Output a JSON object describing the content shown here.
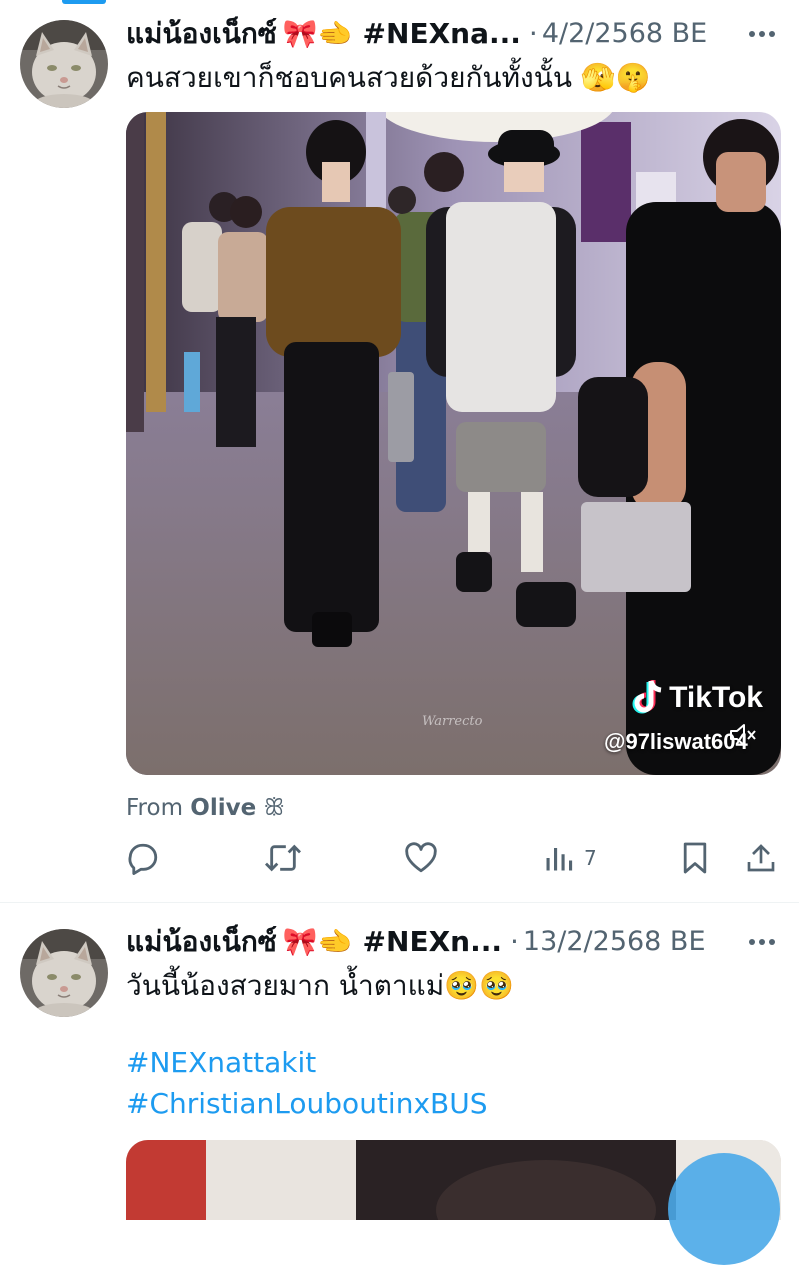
{
  "colors": {
    "accent": "#1d9bf0",
    "text": "#0f1419",
    "secondary": "#536471",
    "divider": "#eff3f4"
  },
  "tweets": [
    {
      "author_name": "แม่น้องเน็กซ์",
      "author_emojis": "🎀🫲",
      "author_hashtag": "#NEXna...",
      "separator": "·",
      "date": "4/2/2568 BE",
      "text": "คนสวยเขาก็ชอบคนสวยด้วยกันทั้งนั้น 🫣🤫",
      "media": {
        "tiktok_brand": "TikTok",
        "tiktok_handle": "@97liswat604",
        "watermark": "Warrecto",
        "muted_icon": "speaker-muted-icon"
      },
      "from_prefix": "From",
      "from_name": "Olive",
      "from_suffix": "ꕥ",
      "actions": {
        "reply_icon": "reply-icon",
        "retweet_icon": "retweet-icon",
        "like_icon": "heart-icon",
        "views_icon": "views-icon",
        "views_count": "7",
        "bookmark_icon": "bookmark-icon",
        "share_icon": "share-icon"
      }
    },
    {
      "author_name": "แม่น้องเน็กซ์",
      "author_emojis": "🎀🫲",
      "author_hashtag": "#NEXn...",
      "separator": "·",
      "date": "13/2/2568 BE",
      "text": "วันนี้น้องสวยมาก น้ำตาแม่🥹🥹",
      "hashtags": [
        "#NEXnattakit",
        "#ChristianLouboutinxBUS"
      ]
    }
  ]
}
